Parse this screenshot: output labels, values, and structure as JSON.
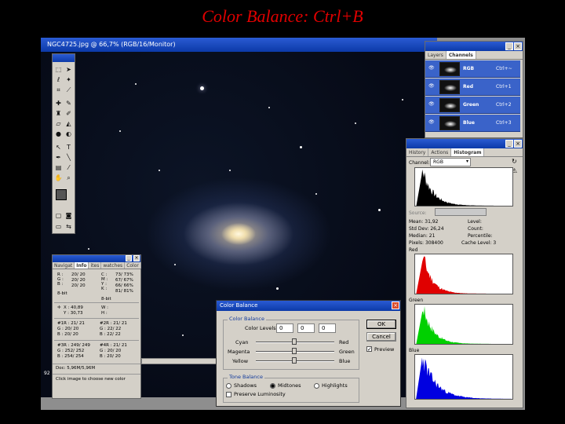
{
  "slide": {
    "title": "Color Balance: Ctrl+B"
  },
  "document": {
    "title": "NGC4725.jpg @ 66,7% (RGB/16/Monitor)",
    "zoom_status": "92",
    "colors": {
      "titlebar": "#0c3aa8"
    }
  },
  "layers_panel": {
    "tabs": [
      "Layers",
      "Channels"
    ],
    "active_tab": "Channels",
    "channels": [
      {
        "name": "RGB",
        "shortcut": "Ctrl+~"
      },
      {
        "name": "Red",
        "shortcut": "Ctrl+1"
      },
      {
        "name": "Green",
        "shortcut": "Ctrl+2"
      },
      {
        "name": "Blue",
        "shortcut": "Ctrl+3"
      }
    ]
  },
  "histogram_panel": {
    "tabs": [
      "History",
      "Actions",
      "Histogram"
    ],
    "channel_label": "Channel:",
    "channel_value": "RGB",
    "source_label": "Source:",
    "stats_left": [
      {
        "label": "Mean:",
        "value": "31,92"
      },
      {
        "label": "Std Dev:",
        "value": "26,24"
      },
      {
        "label": "Median:",
        "value": "21"
      },
      {
        "label": "Pixels:",
        "value": "308400"
      }
    ],
    "stats_right": [
      {
        "label": "Level:",
        "value": ""
      },
      {
        "label": "Count:",
        "value": ""
      },
      {
        "label": "Percentile:",
        "value": ""
      },
      {
        "label": "Cache Level:",
        "value": "3"
      }
    ],
    "channel_labels": [
      "Red",
      "Green",
      "Blue"
    ],
    "colors": {
      "rgb": "#000000",
      "red": "#e00000",
      "green": "#00d000",
      "blue": "#0000e0"
    }
  },
  "info_panel": {
    "tabs": [
      "Navigat",
      "Info",
      "ites",
      "watches",
      "Color"
    ],
    "active_tab": "Info",
    "rgb_block": {
      "r": "20/ 20",
      "g": "20/ 20",
      "b": "20/ 20",
      "bits": "8-bit"
    },
    "cmyk_block": {
      "c": "73/ 73%",
      "m": "67/ 67%",
      "y": "66/ 66%",
      "k": "81/ 81%",
      "bits": "8-bit"
    },
    "xy": {
      "x": "40,89",
      "y": "30,73"
    },
    "wh": {
      "w": "W :",
      "h": "H :"
    },
    "samplers": [
      {
        "id": "#1R :",
        "r": "21/ 21",
        "g": "20/ 20",
        "b": "20/ 20"
      },
      {
        "id": "#2R :",
        "r": "21/ 21",
        "g": "22/ 22",
        "b": "22/ 22"
      },
      {
        "id": "#3R :",
        "r": "249/ 249",
        "g": "252/ 252",
        "b": "254/ 254"
      },
      {
        "id": "#4R :",
        "r": "21/ 21",
        "g": "20/ 20",
        "b": "20/ 20"
      }
    ],
    "doc_size": "Doc: 5,96M/5,96M",
    "hint": "Click image to choose new color"
  },
  "color_balance_dialog": {
    "title": "Color Balance",
    "section_color": "Color Balance",
    "color_levels_label": "Color Levels:",
    "levels": [
      "0",
      "0",
      "0"
    ],
    "sliders": [
      {
        "left": "Cyan",
        "right": "Red"
      },
      {
        "left": "Magenta",
        "right": "Green"
      },
      {
        "left": "Yellow",
        "right": "Blue"
      }
    ],
    "section_tone": "Tone Balance",
    "tone_options": [
      "Shadows",
      "Midtones",
      "Highlights"
    ],
    "tone_selected": "Midtones",
    "preserve_label": "Preserve Luminosity",
    "ok_label": "OK",
    "cancel_label": "Cancel",
    "preview_label": "Preview"
  }
}
